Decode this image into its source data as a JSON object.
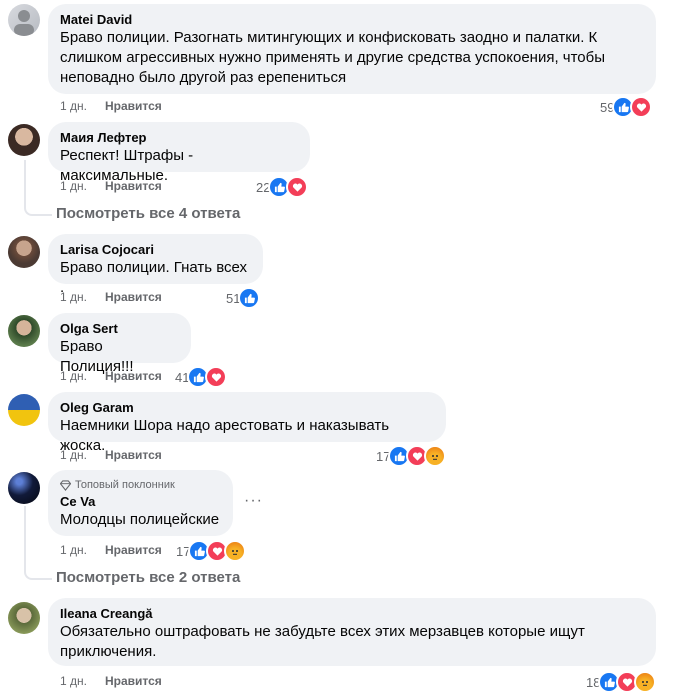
{
  "comments": [
    {
      "author": "Matei David",
      "text": "Браво полиции. Разогнать митингующих и конфисковать заодно и палатки. К слишком агрессивных нужно применять и другие средства успокоения, чтобы неповадно было другой раз ерепениться",
      "time": "1 дн.",
      "like_label": "Нравится",
      "reactions_count": "59"
    },
    {
      "author": "Маия Лефтер",
      "text": "Респект! Штрафы - максимальные.",
      "time": "1 дн.",
      "like_label": "Нравится",
      "reactions_count": "22"
    },
    {
      "author": "Larisa Cojocari",
      "text": "Браво полиции. Гнать всех .",
      "time": "1 дн.",
      "like_label": "Нравится",
      "reactions_count": "51"
    },
    {
      "author": "Olga Sert",
      "text": "Браво Полиция!!!",
      "time": "1 дн.",
      "like_label": "Нравится",
      "reactions_count": "41"
    },
    {
      "author": "Oleg Garam",
      "text": "Наемники Шора надо арестовать и наказывать жоска.",
      "time": "1 дн.",
      "like_label": "Нравится",
      "reactions_count": "17"
    },
    {
      "author": "Ce Va",
      "badge": "Топовый поклонник",
      "text": "Молодцы полицейские",
      "time": "1 дн.",
      "like_label": "Нравится",
      "reactions_count": "17"
    },
    {
      "author": "Ileana Creangă",
      "text": "Обязательно оштрафовать не забудьте всех этих мерзавцев которые ищут приключения.",
      "time": "1 дн.",
      "like_label": "Нравится",
      "reactions_count": "18"
    }
  ],
  "view_replies": [
    {
      "label": "Посмотреть все 4 ответа"
    },
    {
      "label": "Посмотреть все 2 ответа"
    }
  ],
  "colors": {
    "bubble": "#f0f2f5",
    "like": "#1877f2",
    "love": "#f33e58",
    "angry": "#f7b125",
    "secondary_text": "#65676b"
  }
}
